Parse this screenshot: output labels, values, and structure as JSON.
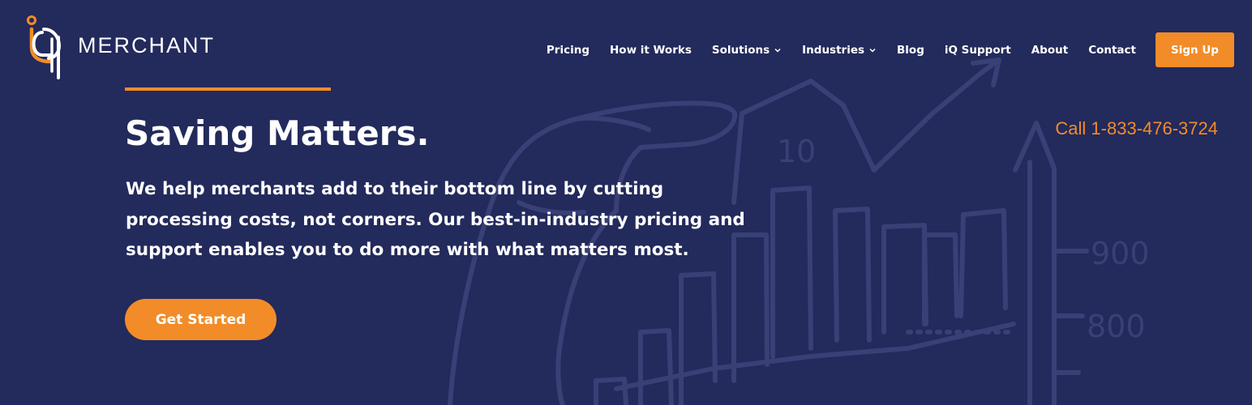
{
  "brand": {
    "name": "MERCHANT",
    "accent_color": "#f28c28",
    "background_color": "#232a5c",
    "logo_icon": "iq-logo-icon"
  },
  "nav": {
    "items": [
      {
        "label": "Pricing",
        "has_dropdown": false
      },
      {
        "label": "How it Works",
        "has_dropdown": false
      },
      {
        "label": "Solutions",
        "has_dropdown": true
      },
      {
        "label": "Industries",
        "has_dropdown": true
      },
      {
        "label": "Blog",
        "has_dropdown": false
      },
      {
        "label": "iQ Support",
        "has_dropdown": false
      },
      {
        "label": "About",
        "has_dropdown": false
      },
      {
        "label": "Contact",
        "has_dropdown": false
      }
    ],
    "signup_label": "Sign Up",
    "dropdown_icon": "chevron-down-icon"
  },
  "hero": {
    "headline": "Saving Matters.",
    "subtext": "We help merchants add to their bottom line by cutting processing costs, not corners. Our best-in-industry pricing and support enables you to do more with what matters most.",
    "cta_label": "Get Started",
    "phone": "Call 1-833-476-3724"
  },
  "background_art": {
    "numbers": [
      "10",
      "900",
      "800"
    ]
  }
}
